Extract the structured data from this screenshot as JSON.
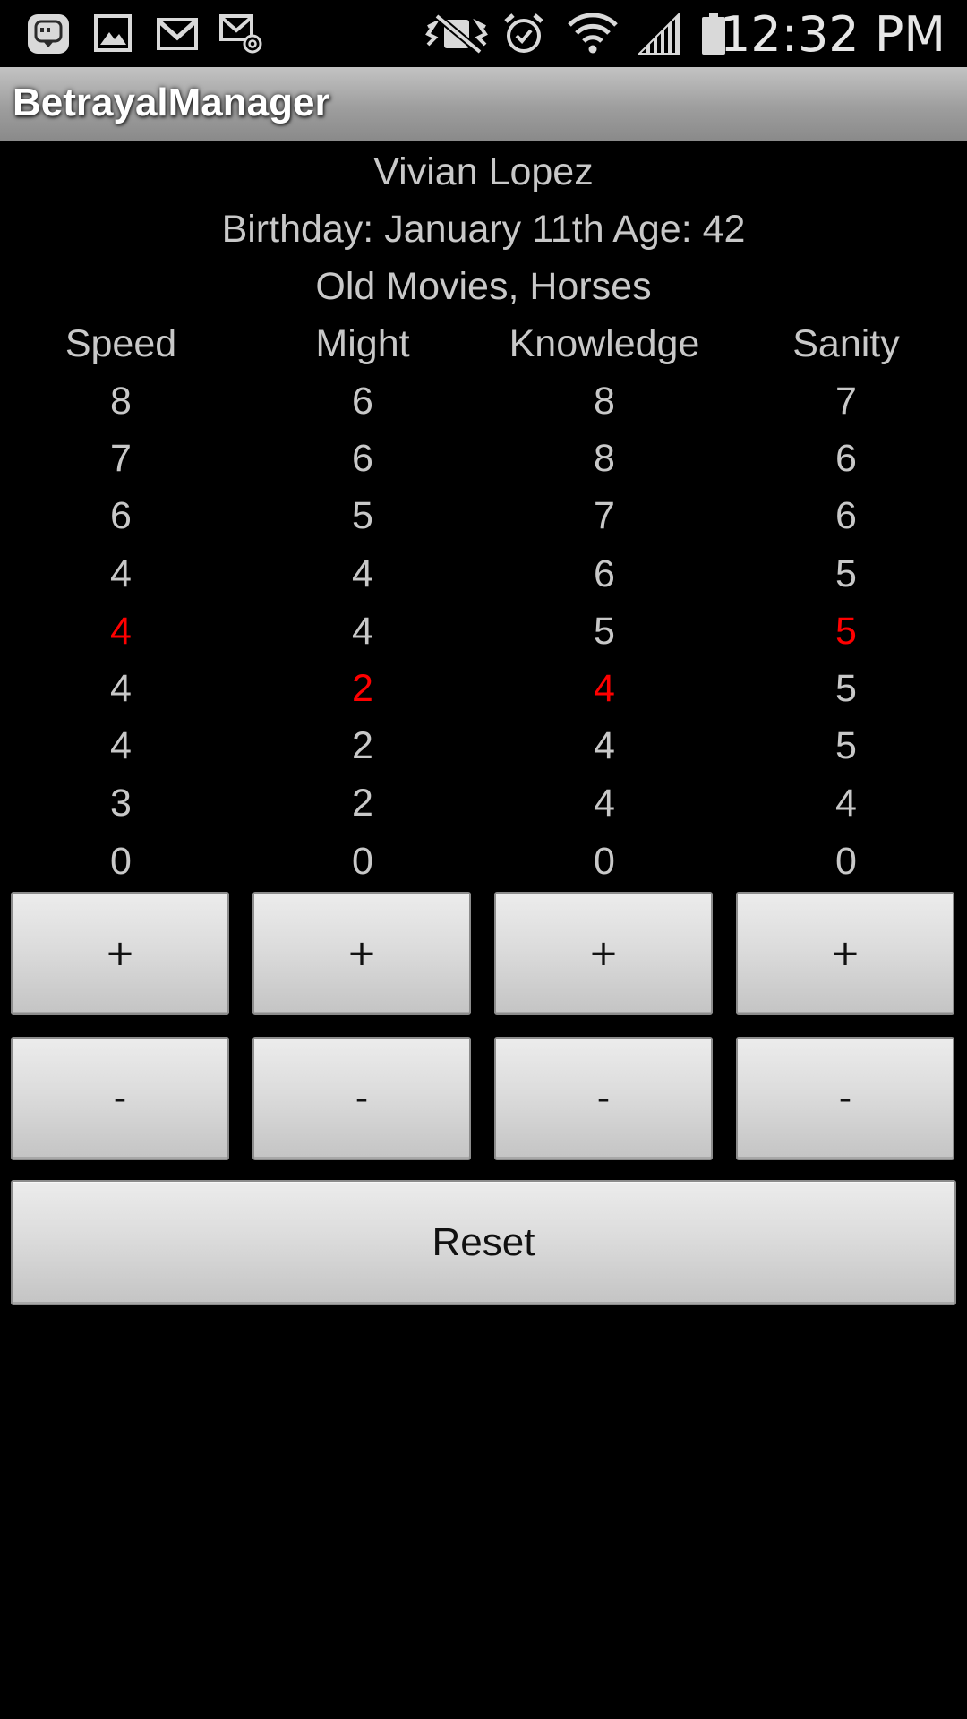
{
  "status_bar": {
    "time": "12:32 PM",
    "icons": [
      "messenger-icon",
      "gallery-icon",
      "gmail-icon",
      "email-icon",
      "mute-vibrate-icon",
      "alarm-icon",
      "wifi-icon",
      "signal-icon",
      "battery-icon"
    ]
  },
  "app": {
    "title": "BetrayalManager"
  },
  "character": {
    "name": "Vivian Lopez",
    "birthday_line": "Birthday: January 11th Age: 42",
    "hobbies": "Old Movies, Horses"
  },
  "stats": {
    "headers": [
      "Speed",
      "Might",
      "Knowledge",
      "Sanity"
    ],
    "current_color": "#ff0000",
    "columns": [
      {
        "name": "Speed",
        "values": [
          "8",
          "7",
          "6",
          "4",
          "4",
          "4",
          "4",
          "3",
          "0"
        ],
        "current_index": 4
      },
      {
        "name": "Might",
        "values": [
          "6",
          "6",
          "5",
          "4",
          "4",
          "2",
          "2",
          "2",
          "0"
        ],
        "current_index": 5
      },
      {
        "name": "Knowledge",
        "values": [
          "8",
          "8",
          "7",
          "6",
          "5",
          "4",
          "4",
          "4",
          "0"
        ],
        "current_index": 5
      },
      {
        "name": "Sanity",
        "values": [
          "7",
          "6",
          "6",
          "5",
          "5",
          "5",
          "5",
          "4",
          "0"
        ],
        "current_index": 4
      }
    ]
  },
  "controls": {
    "plus_label": "+",
    "minus_label": "-",
    "reset_label": "Reset"
  }
}
